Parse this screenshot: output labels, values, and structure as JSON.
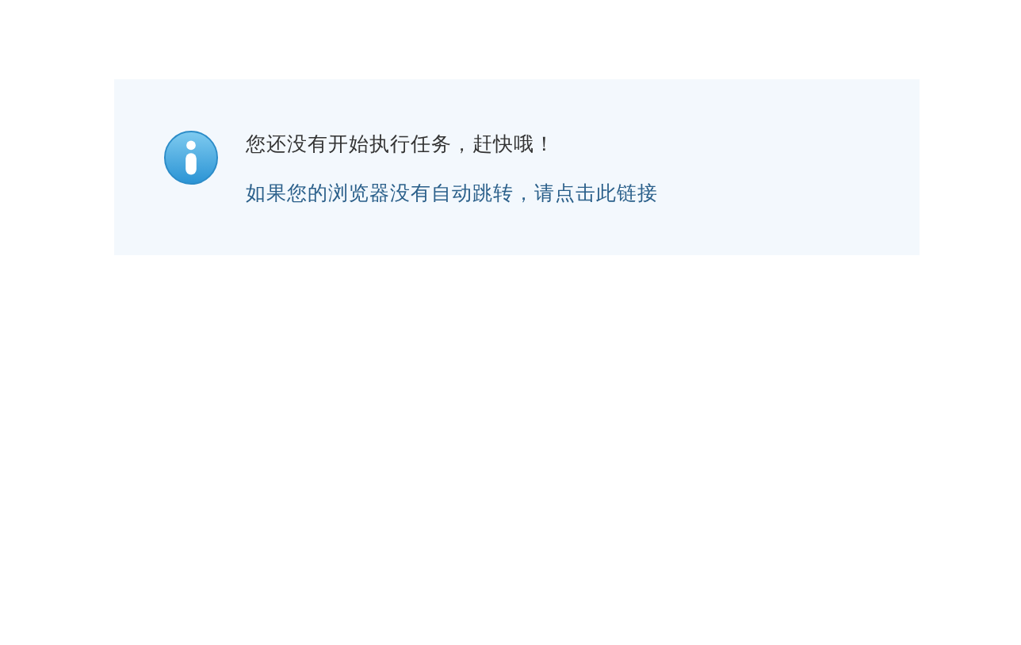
{
  "notice": {
    "message": "您还没有开始执行任务，赶快哦！",
    "link": "如果您的浏览器没有自动跳转，请点击此链接"
  }
}
